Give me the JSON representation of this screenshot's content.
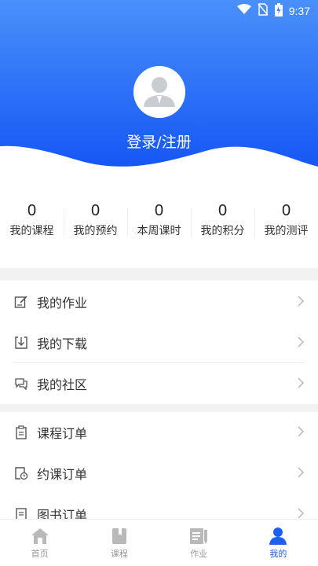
{
  "status": {
    "time": "9:37"
  },
  "profile": {
    "login_label": "登录/注册"
  },
  "stats": [
    {
      "value": "0",
      "label": "我的课程"
    },
    {
      "value": "0",
      "label": "我的预约"
    },
    {
      "value": "0",
      "label": "本周课时"
    },
    {
      "value": "0",
      "label": "我的积分"
    },
    {
      "value": "0",
      "label": "我的测评"
    }
  ],
  "menu_group1": [
    {
      "label": "我的作业",
      "icon": "edit-icon"
    },
    {
      "label": "我的下载",
      "icon": "download-icon"
    },
    {
      "label": "我的社区",
      "icon": "chat-icon"
    }
  ],
  "menu_group2": [
    {
      "label": "课程订单",
      "icon": "clipboard-icon"
    },
    {
      "label": "约课订单",
      "icon": "calendar-clock-icon"
    },
    {
      "label": "图书订单",
      "icon": "book-order-icon"
    }
  ],
  "tabs": [
    {
      "label": "首页",
      "icon": "home-icon",
      "active": false
    },
    {
      "label": "课程",
      "icon": "book-icon",
      "active": false
    },
    {
      "label": "作业",
      "icon": "homework-icon",
      "active": false
    },
    {
      "label": "我的",
      "icon": "user-icon",
      "active": true
    }
  ],
  "colors": {
    "primary": "#1d5ef3",
    "header_gradient_top": "#4a90fa",
    "header_gradient_bottom": "#1a5cf5",
    "background_gap": "#f2f2f2"
  }
}
